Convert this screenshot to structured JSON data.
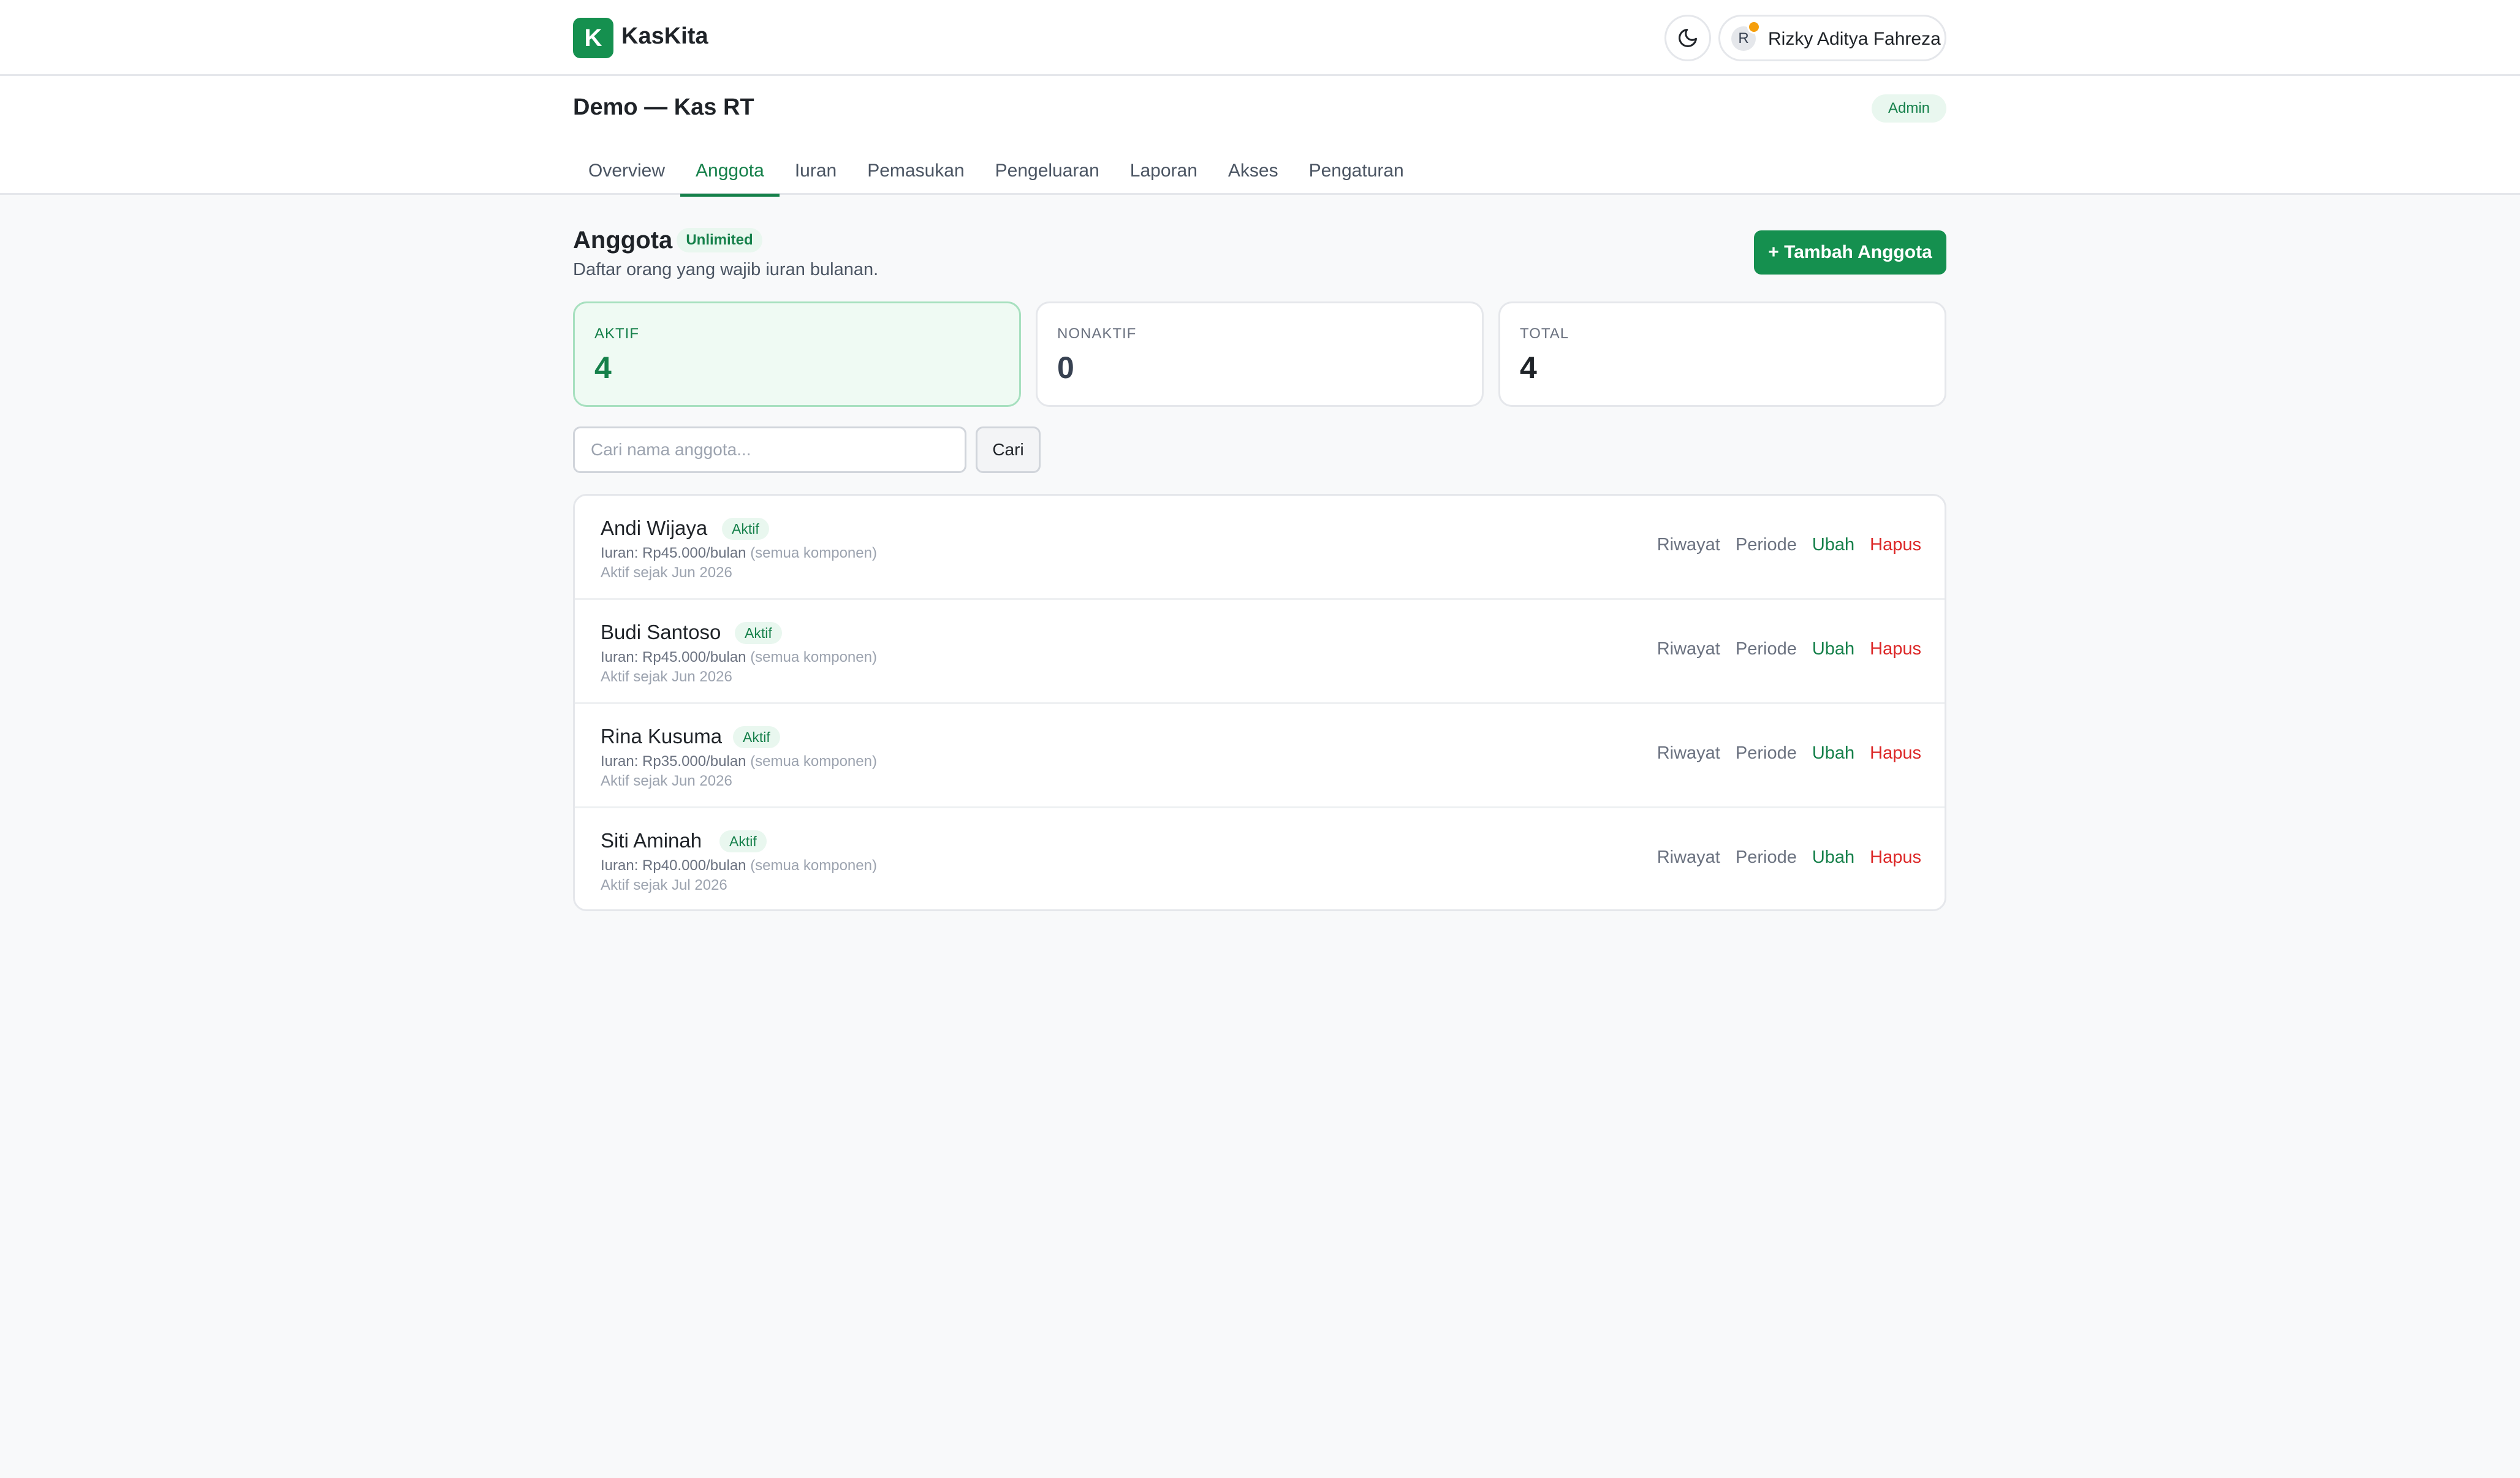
{
  "app": {
    "logo_letter": "K",
    "name": "KasKita"
  },
  "header": {
    "theme_icon": "moon-icon",
    "user": {
      "avatar_initial": "R",
      "name": "Rizky Aditya Fahreza"
    }
  },
  "org": {
    "title": "Demo — Kas RT",
    "role_badge": "Admin"
  },
  "tabs": [
    {
      "label": "Overview"
    },
    {
      "label": "Anggota",
      "active": true
    },
    {
      "label": "Iuran"
    },
    {
      "label": "Pemasukan"
    },
    {
      "label": "Pengeluaran"
    },
    {
      "label": "Laporan"
    },
    {
      "label": "Akses"
    },
    {
      "label": "Pengaturan"
    }
  ],
  "section": {
    "title": "Anggota",
    "badge": "Unlimited",
    "subtitle": "Daftar orang yang wajib iuran bulanan.",
    "add_button": "+ Tambah Anggota"
  },
  "stats": [
    {
      "label": "AKTIF",
      "value": "4"
    },
    {
      "label": "NONAKTIF",
      "value": "0"
    },
    {
      "label": "TOTAL",
      "value": "4"
    }
  ],
  "search": {
    "placeholder": "Cari nama anggota...",
    "value": "",
    "button": "Cari"
  },
  "members": [
    {
      "name": "Andi Wijaya",
      "status": "Aktif",
      "fee": "Iuran: Rp45.000/bulan",
      "fee_note": "(semua komponen)",
      "since": "Aktif sejak Jun 2026"
    },
    {
      "name": "Budi Santoso",
      "status": "Aktif",
      "fee": "Iuran: Rp45.000/bulan",
      "fee_note": "(semua komponen)",
      "since": "Aktif sejak Jun 2026"
    },
    {
      "name": "Rina Kusuma",
      "status": "Aktif",
      "fee": "Iuran: Rp35.000/bulan",
      "fee_note": "(semua komponen)",
      "since": "Aktif sejak Jun 2026"
    },
    {
      "name": "Siti Aminah",
      "status": "Aktif",
      "fee": "Iuran: Rp40.000/bulan",
      "fee_note": "(semua komponen)",
      "since": "Aktif sejak Jul 2026"
    }
  ],
  "row_actions": {
    "history": "Riwayat",
    "period": "Periode",
    "edit": "Ubah",
    "delete": "Hapus"
  },
  "colors": {
    "brand": "#15904f",
    "accent_text": "#15804a",
    "danger": "#dc2626",
    "badge_bg": "#e9f7ef"
  }
}
